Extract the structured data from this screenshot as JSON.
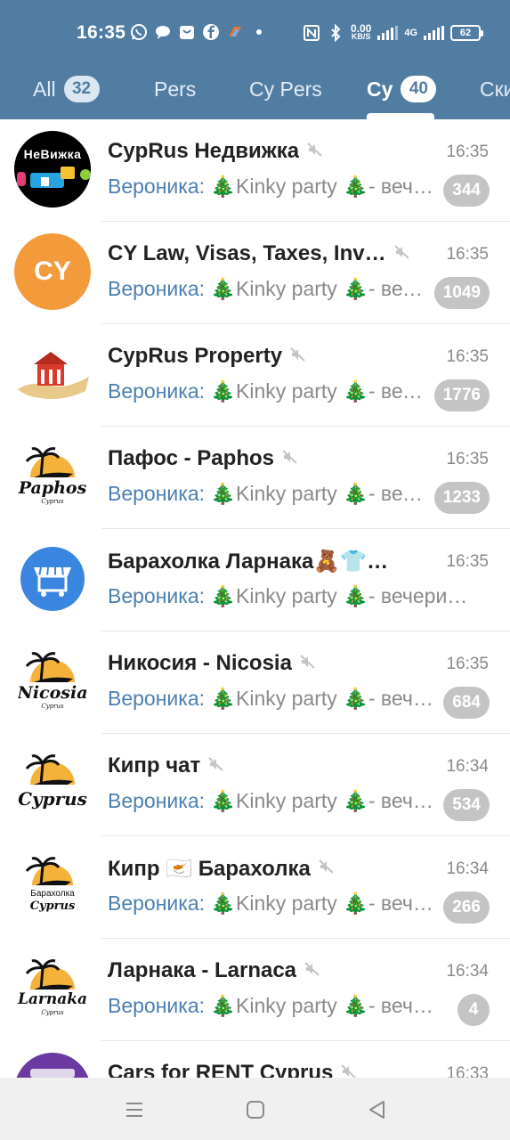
{
  "status_bar": {
    "time": "16:35",
    "speed_value": "0.00",
    "speed_unit": "KB/S",
    "network": "4G",
    "battery": "62"
  },
  "tabs": [
    {
      "label": "All",
      "badge": "32",
      "active": false
    },
    {
      "label": "Pers",
      "badge": "",
      "active": false
    },
    {
      "label": "Cy Pers",
      "badge": "",
      "active": false
    },
    {
      "label": "Cy",
      "badge": "40",
      "active": true
    },
    {
      "label": "Ски",
      "badge": "",
      "active": false
    }
  ],
  "chats": [
    {
      "title": "CypRus Недвижка",
      "time": "16:35",
      "sender": "Вероника:",
      "message": " 🎄Kinky party 🎄- вечеринка",
      "unread": "344",
      "muted": true,
      "avatar_icon": "nedvizhka-logo",
      "avatar_text": "НеВижка"
    },
    {
      "title": "CY Law, Visas, Taxes, Inv…",
      "time": "16:35",
      "sender": "Вероника:",
      "message": " 🎄Kinky party 🎄- вечеринка",
      "unread": "1049",
      "muted": true,
      "avatar_icon": "cy-initials",
      "avatar_text": "CY"
    },
    {
      "title": "CypRus Property",
      "time": "16:35",
      "sender": "Вероника:",
      "message": " 🎄Kinky party 🎄- вечеринка",
      "unread": "1776",
      "muted": true,
      "avatar_icon": "property-logo",
      "avatar_text": ""
    },
    {
      "title": "Пафос - Paphos",
      "time": "16:35",
      "sender": "Вероника:",
      "message": " 🎄Kinky party 🎄- вечеринка",
      "unread": "1233",
      "muted": true,
      "avatar_icon": "palm-sunset-logo",
      "avatar_text": "Paphos"
    },
    {
      "title": "Барахолка Ларнака🧸👕…",
      "time": "16:35",
      "sender": "Вероника:",
      "message": " 🎄Kinky party 🎄- вечеринка",
      "unread": "",
      "muted": false,
      "avatar_icon": "market-stall-logo",
      "avatar_text": ""
    },
    {
      "title": "Никосия - Nicosia",
      "time": "16:35",
      "sender": "Вероника:",
      "message": " 🎄Kinky party 🎄- вечеринка",
      "unread": "684",
      "muted": true,
      "avatar_icon": "palm-sunset-logo",
      "avatar_text": "Nicosia"
    },
    {
      "title": "Кипр чат",
      "time": "16:34",
      "sender": "Вероника:",
      "message": " 🎄Kinky party 🎄- вечеринка",
      "unread": "534",
      "muted": true,
      "avatar_icon": "palm-sunset-logo",
      "avatar_text": "Cyprus"
    },
    {
      "title": "Кипр 🇨🇾 Барахолка",
      "time": "16:34",
      "sender": "Вероника:",
      "message": " 🎄Kinky party 🎄- вечеринка",
      "unread": "266",
      "muted": true,
      "avatar_icon": "palm-sunset-logo",
      "avatar_text": "Cyprus"
    },
    {
      "title": "Ларнака - Larnaca",
      "time": "16:34",
      "sender": "Вероника:",
      "message": " 🎄Kinky party 🎄- вечеринка",
      "unread": "4",
      "muted": true,
      "avatar_icon": "palm-sunset-logo",
      "avatar_text": "Larnaka"
    },
    {
      "title": "Cars for RENT Cyprus",
      "time": "16:33",
      "sender": "",
      "message": "",
      "unread": "",
      "muted": true,
      "avatar_icon": "cars-logo",
      "avatar_text": ""
    }
  ],
  "palm_captions": {
    "small": "Cyprus",
    "baraholka": "Барахолка"
  },
  "navbar": {
    "menu_icon": "menu-lines-icon",
    "home_icon": "home-square-icon",
    "back_icon": "back-triangle-icon"
  },
  "colors": {
    "header": "#527da3",
    "sender": "#4b7fb3",
    "badge": "#c4c4c4",
    "cy_avatar": "#f39a3b",
    "market_avatar": "#3a85e0"
  }
}
